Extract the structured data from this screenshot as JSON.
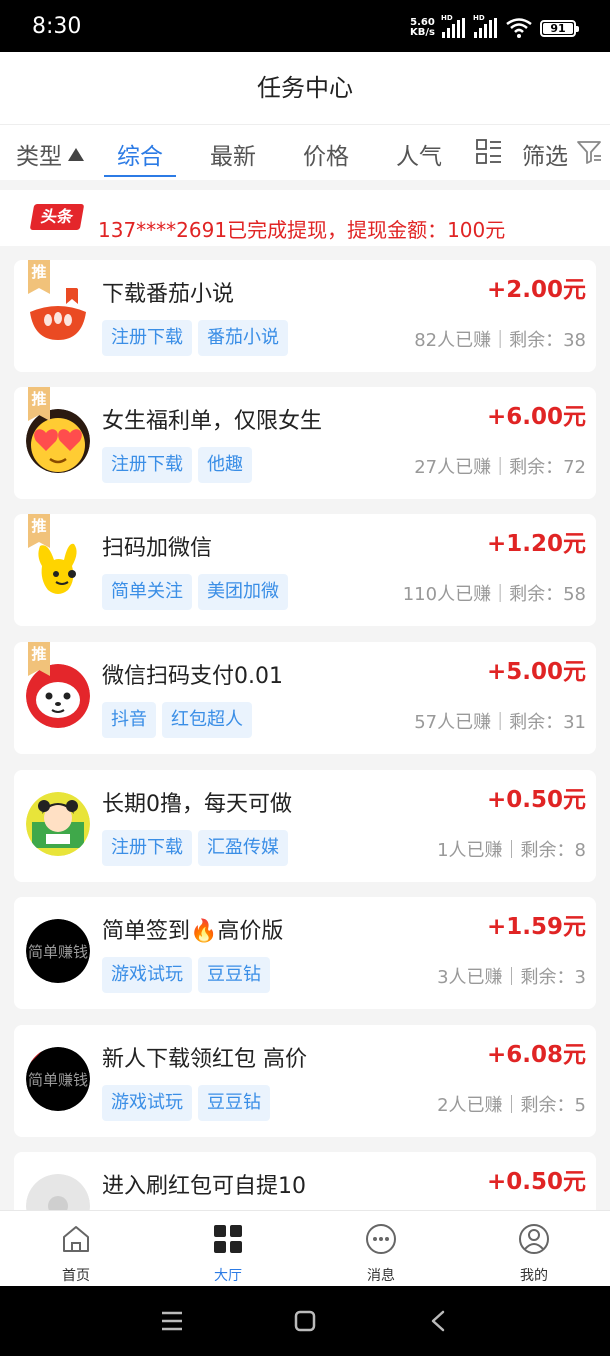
{
  "status_bar": {
    "time": "8:30",
    "net_speed_value": "5.60",
    "net_speed_unit": "KB/s",
    "hd1": "HD",
    "hd2": "HD",
    "battery": "91"
  },
  "header": {
    "title": "任务中心"
  },
  "tabs": {
    "type_label": "类型",
    "items": [
      {
        "label": "综合",
        "active": true
      },
      {
        "label": "最新"
      },
      {
        "label": "价格"
      },
      {
        "label": "人气"
      }
    ],
    "filter_label": "筛选",
    "accent_color": "#2c7be5"
  },
  "ticker": {
    "badge": "头条",
    "text": "137****2691已完成提现，提现金额：100元"
  },
  "recommend_badge": "推",
  "avatar_text": "简单赚钱",
  "tasks": [
    {
      "title": "下载番茄小说",
      "price": "+2.00元",
      "tags": [
        "注册下载",
        "番茄小说"
      ],
      "stats": "82人已赚｜剩余：38",
      "icon": "tomato-novel-icon",
      "recommended": true
    },
    {
      "title": "女生福利单，仅限女生",
      "price": "+6.00元",
      "tags": [
        "注册下载",
        "他趣"
      ],
      "stats": "27人已赚｜剩余：72",
      "icon": "heart-eyes-emoji-icon",
      "recommended": true
    },
    {
      "title": "扫码加微信",
      "price": "+1.20元",
      "tags": [
        "简单关注",
        "美团加微"
      ],
      "stats": "110人已赚｜剩余：58",
      "icon": "yellow-rabbit-icon",
      "recommended": true
    },
    {
      "title": "微信扫码支付0.01",
      "price": "+5.00元",
      "tags": [
        "抖音",
        "红包超人"
      ],
      "stats": "57人已赚｜剩余：31",
      "icon": "panda-face-icon",
      "recommended": true
    },
    {
      "title": "长期0撸，每天可做",
      "price": "+0.50元",
      "tags": [
        "注册下载",
        "汇盈传媒"
      ],
      "stats": "1人已赚｜剩余：8",
      "icon": "cartoon-girl-icon",
      "recommended": false
    },
    {
      "title": "简单签到🔥高价版",
      "price": "+1.59元",
      "tags": [
        "游戏试玩",
        "豆豆钻"
      ],
      "stats": "3人已赚｜剩余：3",
      "icon": "simple-money-icon",
      "recommended": false
    },
    {
      "title": "新人下载领红包 高价",
      "price": "+6.08元",
      "tags": [
        "游戏试玩",
        "豆豆钻"
      ],
      "stats": "2人已赚｜剩余：5",
      "icon": "simple-money-icon",
      "recommended": false
    },
    {
      "title": "进入刷红包可自提10",
      "price": "+0.50元",
      "tags": [],
      "stats": "",
      "icon": "default-avatar-icon",
      "recommended": false
    }
  ],
  "bottom_nav": [
    {
      "label": "首页",
      "icon": "home-icon"
    },
    {
      "label": "大厅",
      "icon": "grid-icon",
      "active": true
    },
    {
      "label": "消息",
      "icon": "message-icon"
    },
    {
      "label": "我的",
      "icon": "profile-icon"
    }
  ],
  "colors": {
    "price_red": "#e02424",
    "tag_bg": "#eaf3fd",
    "tag_text": "#3a8ee6",
    "recommend_orange": "#f1c27a"
  }
}
